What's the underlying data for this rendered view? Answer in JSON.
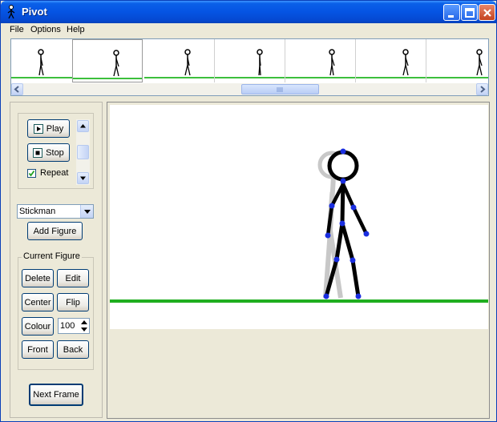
{
  "window": {
    "title": "Pivot"
  },
  "menu": [
    "File",
    "Options",
    "Help"
  ],
  "timeline": {
    "frame_count": 7,
    "selected_frame": 2
  },
  "playback": {
    "play_label": "Play",
    "stop_label": "Stop",
    "repeat_label": "Repeat",
    "repeat_checked": true
  },
  "figure_select": {
    "value": "Stickman",
    "add_label": "Add Figure"
  },
  "current_figure": {
    "title": "Current Figure",
    "delete_label": "Delete",
    "edit_label": "Edit",
    "center_label": "Center",
    "flip_label": "Flip",
    "colour_label": "Colour",
    "colour_value": "100",
    "front_label": "Front",
    "back_label": "Back"
  },
  "next_frame_label": "Next Frame",
  "colors": {
    "ground": "#1fae1f",
    "joint": "#1a2ee0",
    "ghost": "#c8c8c8"
  }
}
